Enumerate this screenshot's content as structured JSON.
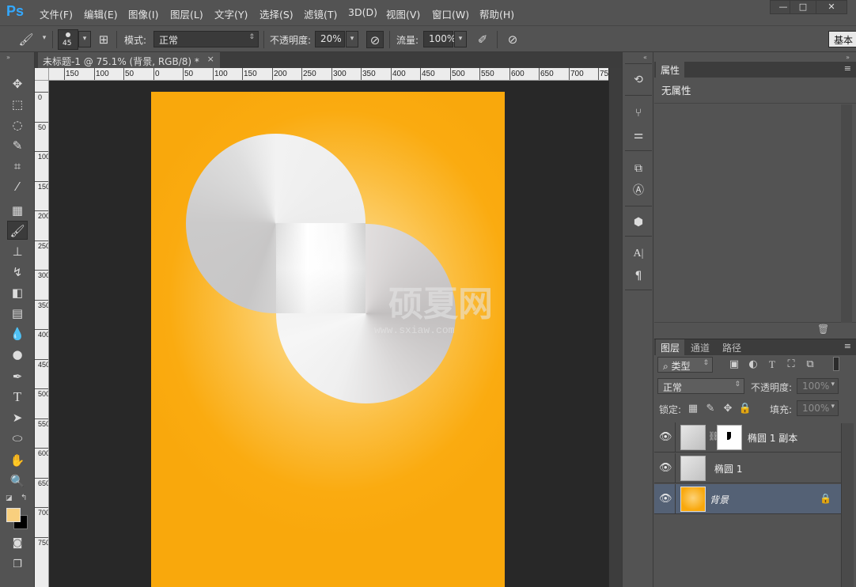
{
  "app": {
    "logo": "Ps"
  },
  "menu": [
    "文件(F)",
    "编辑(E)",
    "图像(I)",
    "图层(L)",
    "文字(Y)",
    "选择(S)",
    "滤镜(T)",
    "3D(D)",
    "视图(V)",
    "窗口(W)",
    "帮助(H)"
  ],
  "window_controls": {
    "minimize": "—",
    "maximize": "□",
    "close": "✕"
  },
  "options": {
    "brush_size": "45",
    "mode_label": "模式:",
    "mode_value": "正常",
    "opacity_label": "不透明度:",
    "opacity_value": "20%",
    "flow_label": "流量:",
    "flow_value": "100%",
    "workspace": "基本"
  },
  "document": {
    "tab_title": "未标题-1 @ 75.1% (背景, RGB/8) *",
    "close": "×",
    "ruler_h": [
      "150",
      "100",
      "50",
      "0",
      "50",
      "100",
      "150",
      "200",
      "250",
      "300",
      "350",
      "400",
      "450",
      "500",
      "550",
      "600",
      "650",
      "700",
      "75"
    ],
    "ruler_v": [
      "0",
      "50",
      "100",
      "150",
      "200",
      "250",
      "300",
      "350",
      "400",
      "450",
      "500",
      "550",
      "600",
      "650",
      "700",
      "750"
    ],
    "watermark": "硕夏网",
    "watermark_url": "www.sxiaw.com"
  },
  "colors": {
    "foreground": "#f8cf7e",
    "background": "#000000",
    "canvas_orange": "#f9a80c",
    "selected_layer": "#546175"
  },
  "properties": {
    "tab": "属性",
    "title": "无属性"
  },
  "layers": {
    "tabs": [
      "图层",
      "通道",
      "路径"
    ],
    "filter": "类型",
    "blend": "正常",
    "opacity_label": "不透明度:",
    "opacity_value": "100%",
    "lock_label": "锁定:",
    "fill_label": "填充:",
    "fill_value": "100%",
    "items": [
      {
        "name": "椭圆 1 副本",
        "selected": false,
        "has_mask": true
      },
      {
        "name": "椭圆 1",
        "selected": false,
        "has_mask": false
      },
      {
        "name": "背景",
        "selected": true,
        "locked": true
      }
    ]
  }
}
